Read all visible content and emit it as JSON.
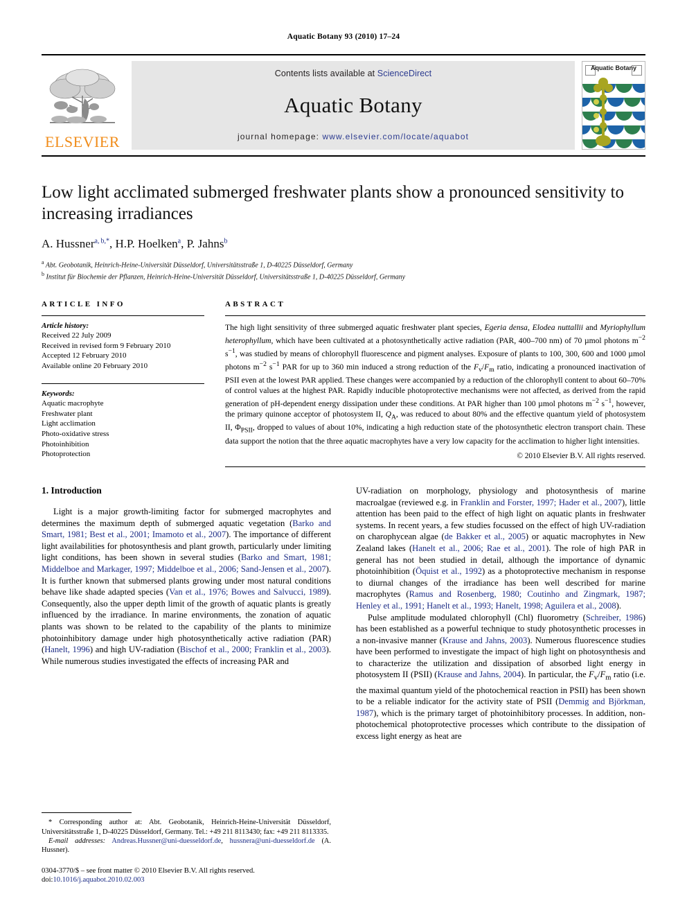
{
  "running_head": "Aquatic Botany 93 (2010) 17–24",
  "masthead": {
    "elsevier_wordmark": "ELSEVIER",
    "contents_prefix": "Contents lists available at ",
    "contents_link": "ScienceDirect",
    "journal_name": "Aquatic Botany",
    "homepage_prefix": "journal homepage: ",
    "homepage_url": "www.elsevier.com/locate/aquabot",
    "cover_title": "Aquatic Botany",
    "accent_orange": "#f08c1a",
    "link_blue": "#2b3a8f"
  },
  "article": {
    "title": "Low light acclimated submerged freshwater plants show a pronounced sensitivity to increasing irradiances",
    "authors": "A. Hussner",
    "authors_full": "A. Hussnera,b,*, H.P. Hoelkena, P. Jahnsb",
    "author_list": [
      {
        "name": "A. Hussner",
        "sup": "a, b,*"
      },
      {
        "name": "H.P. Hoelken",
        "sup": "a"
      },
      {
        "name": "P. Jahns",
        "sup": "b"
      }
    ],
    "affiliations": [
      {
        "marker": "a",
        "text": "Abt. Geobotanik, Heinrich-Heine-Universität Düsseldorf, Universitätsstraße 1, D-40225 Düsseldorf, Germany"
      },
      {
        "marker": "b",
        "text": "Institut für Biochemie der Pflanzen, Heinrich-Heine-Universität Düsseldorf, Universitätsstraße 1, D-40225 Düsseldorf, Germany"
      }
    ]
  },
  "article_info": {
    "heading": "ARTICLE INFO",
    "history_label": "Article history:",
    "history": [
      "Received 22 July 2009",
      "Received in revised form 9 February 2010",
      "Accepted 12 February 2010",
      "Available online 20 February 2010"
    ],
    "keywords_label": "Keywords:",
    "keywords": [
      "Aquatic macrophyte",
      "Freshwater plant",
      "Light acclimation",
      "Photo-oxidative stress",
      "Photoinhibition",
      "Photoprotection"
    ]
  },
  "abstract": {
    "heading": "ABSTRACT",
    "text_html": "The high light sensitivity of three submerged aquatic freshwater plant species, <i>Egeria densa</i>, <i>Elodea nuttallii</i> and <i>Myriophyllum heterophyllum</i>, which have been cultivated at a photosynthetically active radiation (PAR, 400–700 nm) of 70 &#181;mol photons m<sup>&#8722;2</sup> s<sup>&#8722;1</sup>, was studied by means of chlorophyll fluorescence and pigment analyses. Exposure of plants to 100, 300, 600 and 1000 &#181;mol photons m<sup>&#8722;2</sup> s<sup>&#8722;1</sup> PAR for up to 360 min induced a strong reduction of the <i>F</i><sub>v</sub>/<i>F</i><sub>m</sub> ratio, indicating a pronounced inactivation of PSII even at the lowest PAR applied. These changes were accompanied by a reduction of the chlorophyll content to about 60&#8211;70% of control values at the highest PAR. Rapidly inducible photoprotective mechanisms were not affected, as derived from the rapid generation of pH-dependent energy dissipation under these conditions. At PAR higher than 100 &#181;mol photons m<sup>&#8722;2</sup> s<sup>&#8722;1</sup>, however, the primary quinone acceptor of photosystem II, <i>Q</i><sub>A</sub>, was reduced to about 80% and the effective quantum yield of photosystem II, &#934;<sub>PSII</sub>, dropped to values of about 10%, indicating a high reduction state of the photosynthetic electron transport chain. These data support the notion that the three aquatic macrophytes have a very low capacity for the acclimation to higher light intensities.",
    "copyright": "© 2010 Elsevier B.V. All rights reserved."
  },
  "introduction": {
    "heading": "1.  Introduction",
    "left_paragraph_html": "Light is a major growth-limiting factor for submerged macrophytes and determines the maximum depth of submerged aquatic vegetation (<span class=\"cite\">Barko and Smart, 1981; Best et al., 2001; Imamoto et al., 2007</span>). The importance of different light availabilities for photosynthesis and plant growth, particularly under limiting light conditions, has been shown in several studies (<span class=\"cite\">Barko and Smart, 1981; Middelboe and Markager, 1997; Middelboe et al., 2006; Sand-Jensen et al., 2007</span>). It is further known that submersed plants growing under most natural conditions behave like shade adapted species (<span class=\"cite\">Van et al., 1976; Bowes and Salvucci, 1989</span>). Consequently, also the upper depth limit of the growth of aquatic plants is greatly influenced by the irradiance. In marine environments, the zonation of aquatic plants was shown to be related to the capability of the plants to minimize photoinhibitory damage under high photosynthetically active radiation (PAR) (<span class=\"cite\">Hanelt, 1996</span>) and high UV-radiation (<span class=\"cite\">Bischof et al., 2000; Franklin et al., 2003</span>). While numerous studies investigated the effects of increasing PAR and",
    "right_paragraph1_html": "UV-radiation on morphology, physiology and photosynthesis of marine macroalgae (reviewed e.g. in <span class=\"cite\">Franklin and Forster, 1997; Hader et al., 2007</span>), little attention has been paid to the effect of high light on aquatic plants in freshwater systems. In recent years, a few studies focussed on the effect of high UV-radiation on charophycean algae (<span class=\"cite\">de Bakker et al., 2005</span>) or aquatic macrophytes in New Zealand lakes (<span class=\"cite\">Hanelt et al., 2006; Rae et al., 2001</span>). The role of high PAR in general has not been studied in detail, although the importance of dynamic photoinhibition (<span class=\"cite\">Öquist et al., 1992</span>) as a photoprotective mechanism in response to diurnal changes of the irradiance has been well described for marine macrophytes (<span class=\"cite\">Ramus and Rosenberg, 1980; Coutinho and Zingmark, 1987; Henley et al., 1991; Hanelt et al., 1993; Hanelt, 1998; Aguilera et al., 2008</span>).",
    "right_paragraph2_html": "Pulse amplitude modulated chlorophyll (Chl) fluorometry (<span class=\"cite\">Schreiber, 1986</span>) has been established as a powerful technique to study photosynthetic processes in a non-invasive manner (<span class=\"cite\">Krause and Jahns, 2003</span>). Numerous fluorescence studies have been performed to investigate the impact of high light on photosynthesis and to characterize the utilization and dissipation of absorbed light energy in photosystem II (PSII) (<span class=\"cite\">Krause and Jahns, 2004</span>). In particular, the <i>F</i><sub>v</sub>/<i>F</i><sub>m</sub> ratio (i.e. the maximal quantum yield of the photochemical reaction in PSII) has been shown to be a reliable indicator for the activity state of PSII (<span class=\"cite\">Demmig and Björkman, 1987</span>), which is the primary target of photoinhibitory processes. In addition, non-photochemical photoprotective processes which contribute to the dissipation of excess light energy as heat are"
  },
  "footnotes": {
    "corresponding_html": "* Corresponding author at: Abt. Geobotanik, Heinrich-Heine-Universität Düsseldorf, Universitätsstraße 1, D-40225 Düsseldorf, Germany. Tel.: +49 211 8113430; fax: +49 211 8113335.",
    "email_html": "<i>E-mail addresses:</i> <span class=\"mail\">Andreas.Hussner@uni-duesseldorf.de</span>, <span class=\"mail\">hussnera@uni-duesseldorf.de</span> (A. Hussner).",
    "issn_html": "0304-3770/$ – see front matter © 2010 Elsevier B.V. All rights reserved.",
    "doi_html": "doi:<span class=\"doi\">10.1016/j.aquabot.2010.02.003</span>"
  }
}
